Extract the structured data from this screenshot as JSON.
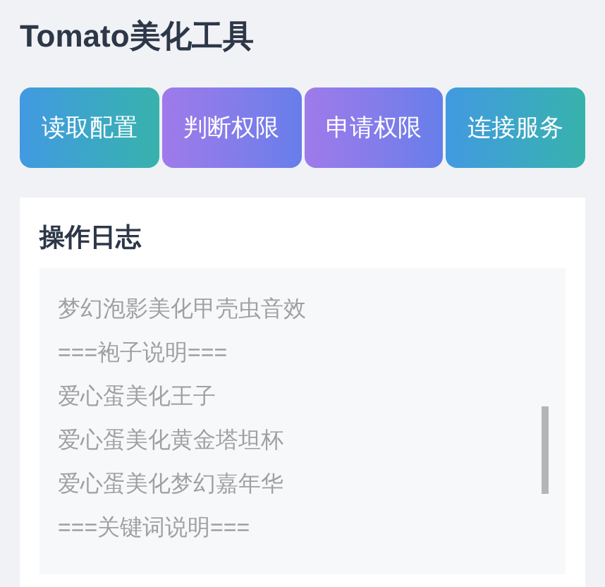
{
  "app": {
    "title": "Tomato美化工具"
  },
  "buttons": [
    {
      "label": "读取配置",
      "kind": "teal"
    },
    {
      "label": "判断权限",
      "kind": "violet"
    },
    {
      "label": "申请权限",
      "kind": "violet"
    },
    {
      "label": "连接服务",
      "kind": "teal"
    }
  ],
  "log": {
    "title": "操作日志",
    "lines": [
      "梦幻泡影美化甲壳虫音效",
      "===袍子说明===",
      "爱心蛋美化王子",
      "爱心蛋美化黄金塔坦杯",
      "爱心蛋美化梦幻嘉年华",
      "===关键词说明==="
    ]
  }
}
